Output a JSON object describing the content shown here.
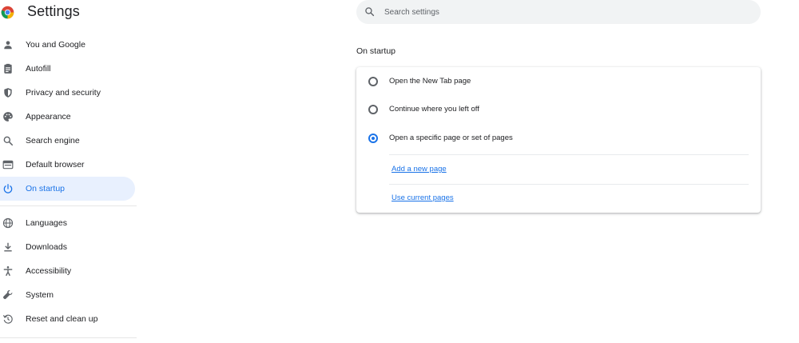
{
  "header": {
    "title": "Settings",
    "logo_icon": "chrome-logo-icon"
  },
  "search": {
    "placeholder": "Search settings",
    "value": ""
  },
  "sidebar": {
    "items": [
      {
        "label": "You and Google",
        "icon": "person-icon"
      },
      {
        "label": "Autofill",
        "icon": "clipboard-icon"
      },
      {
        "label": "Privacy and security",
        "icon": "shield-icon"
      },
      {
        "label": "Appearance",
        "icon": "palette-icon"
      },
      {
        "label": "Search engine",
        "icon": "search-icon"
      },
      {
        "label": "Default browser",
        "icon": "browser-icon"
      },
      {
        "label": "On startup",
        "icon": "power-icon",
        "active": true
      },
      {
        "label": "Languages",
        "icon": "globe-icon"
      },
      {
        "label": "Downloads",
        "icon": "download-icon"
      },
      {
        "label": "Accessibility",
        "icon": "accessibility-icon"
      },
      {
        "label": "System",
        "icon": "wrench-icon"
      },
      {
        "label": "Reset and clean up",
        "icon": "restore-icon"
      }
    ]
  },
  "main": {
    "section_title": "On startup",
    "options": [
      {
        "label": "Open the New Tab page",
        "checked": false
      },
      {
        "label": "Continue where you left off",
        "checked": false
      },
      {
        "label": "Open a specific page or set of pages",
        "checked": true
      }
    ],
    "links": {
      "add_page": "Add a new page",
      "use_current": "Use current pages"
    }
  },
  "colors": {
    "accent": "#1a73e8",
    "active_bg": "#e8f0fe",
    "text": "#202124",
    "icon": "#5f6368"
  }
}
